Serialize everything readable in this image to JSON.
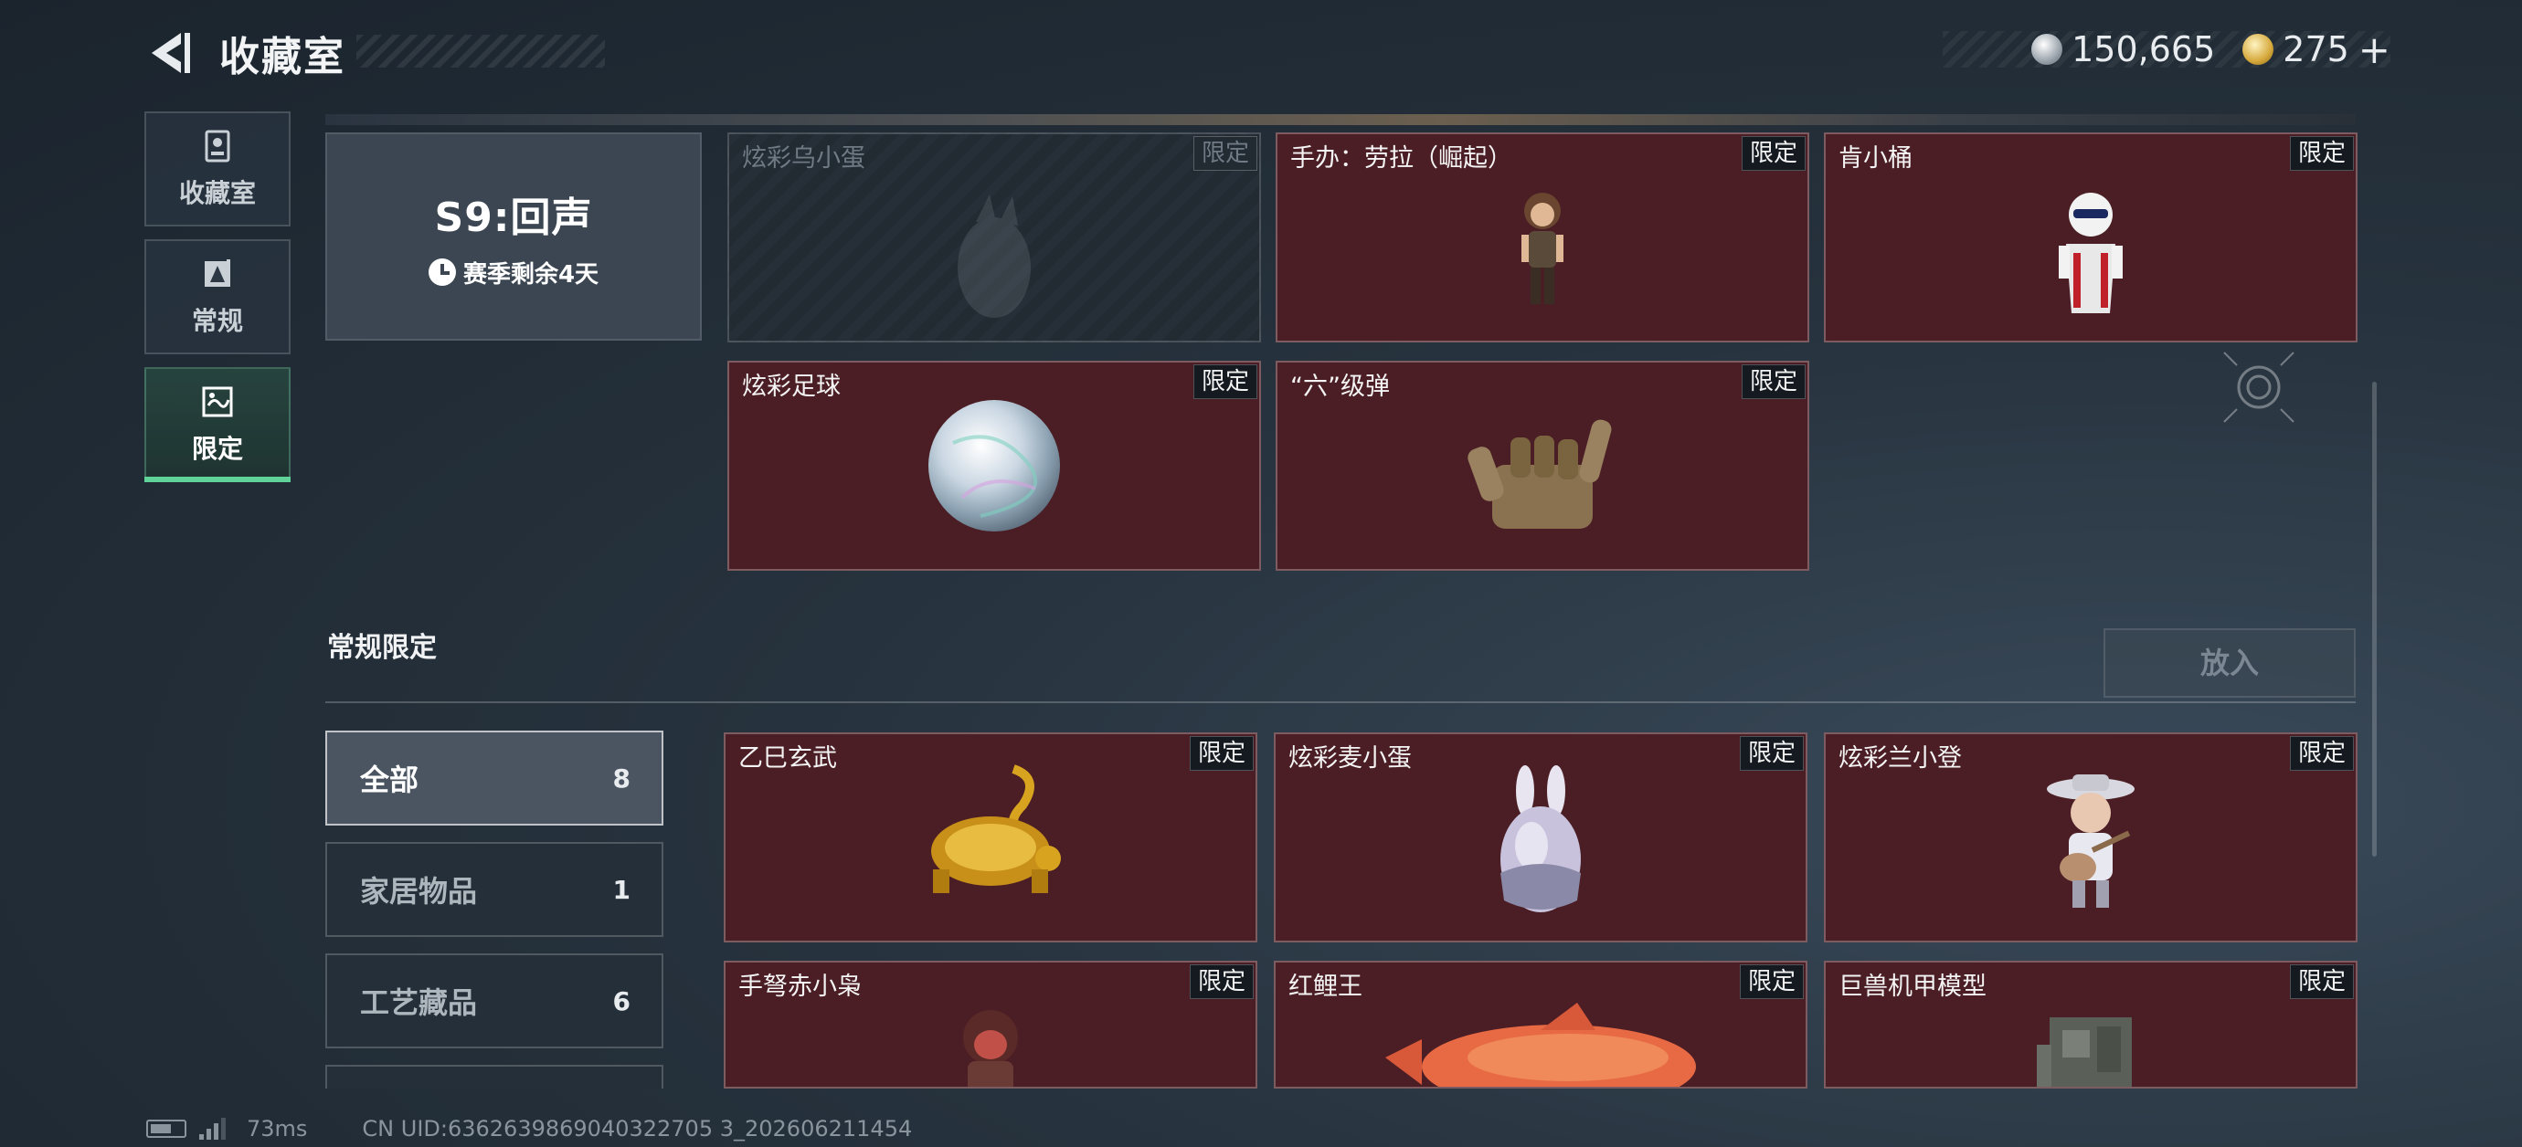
{
  "header": {
    "title": "收藏室",
    "currency_silver": "150,665",
    "currency_gold": "275",
    "plus": "+"
  },
  "nav": {
    "items": [
      {
        "label": "收藏室",
        "icon": "collection-icon"
      },
      {
        "label": "常规",
        "icon": "regular-icon"
      },
      {
        "label": "限定",
        "icon": "limited-icon"
      }
    ]
  },
  "season": {
    "title": "S9:回声",
    "remaining": "赛季剩余4天"
  },
  "season_items": [
    {
      "name": "炫彩乌小蛋",
      "badge": "限定",
      "locked": true
    },
    {
      "name": "手办：劳拉（崛起）",
      "badge": "限定",
      "locked": false
    },
    {
      "name": "肯小桶",
      "badge": "限定",
      "locked": false
    },
    {
      "name": "炫彩足球",
      "badge": "限定",
      "locked": false
    },
    {
      "name": "“六”级弹",
      "badge": "限定",
      "locked": false
    }
  ],
  "section": {
    "title": "常规限定",
    "place_button": "放入"
  },
  "categories": [
    {
      "name": "全部",
      "count": "8"
    },
    {
      "name": "家居物品",
      "count": "1"
    },
    {
      "name": "工艺藏品",
      "count": "6"
    }
  ],
  "regular_items": [
    {
      "name": "乙巳玄武",
      "badge": "限定"
    },
    {
      "name": "炫彩麦小蛋",
      "badge": "限定"
    },
    {
      "name": "炫彩兰小登",
      "badge": "限定"
    },
    {
      "name": "手弩赤小枭",
      "badge": "限定"
    },
    {
      "name": "红鲤王",
      "badge": "限定"
    },
    {
      "name": "巨兽机甲模型",
      "badge": "限定"
    }
  ],
  "status": {
    "ping": "73ms",
    "uid": "CN UID:6362639869040322705 3_202606211454"
  }
}
